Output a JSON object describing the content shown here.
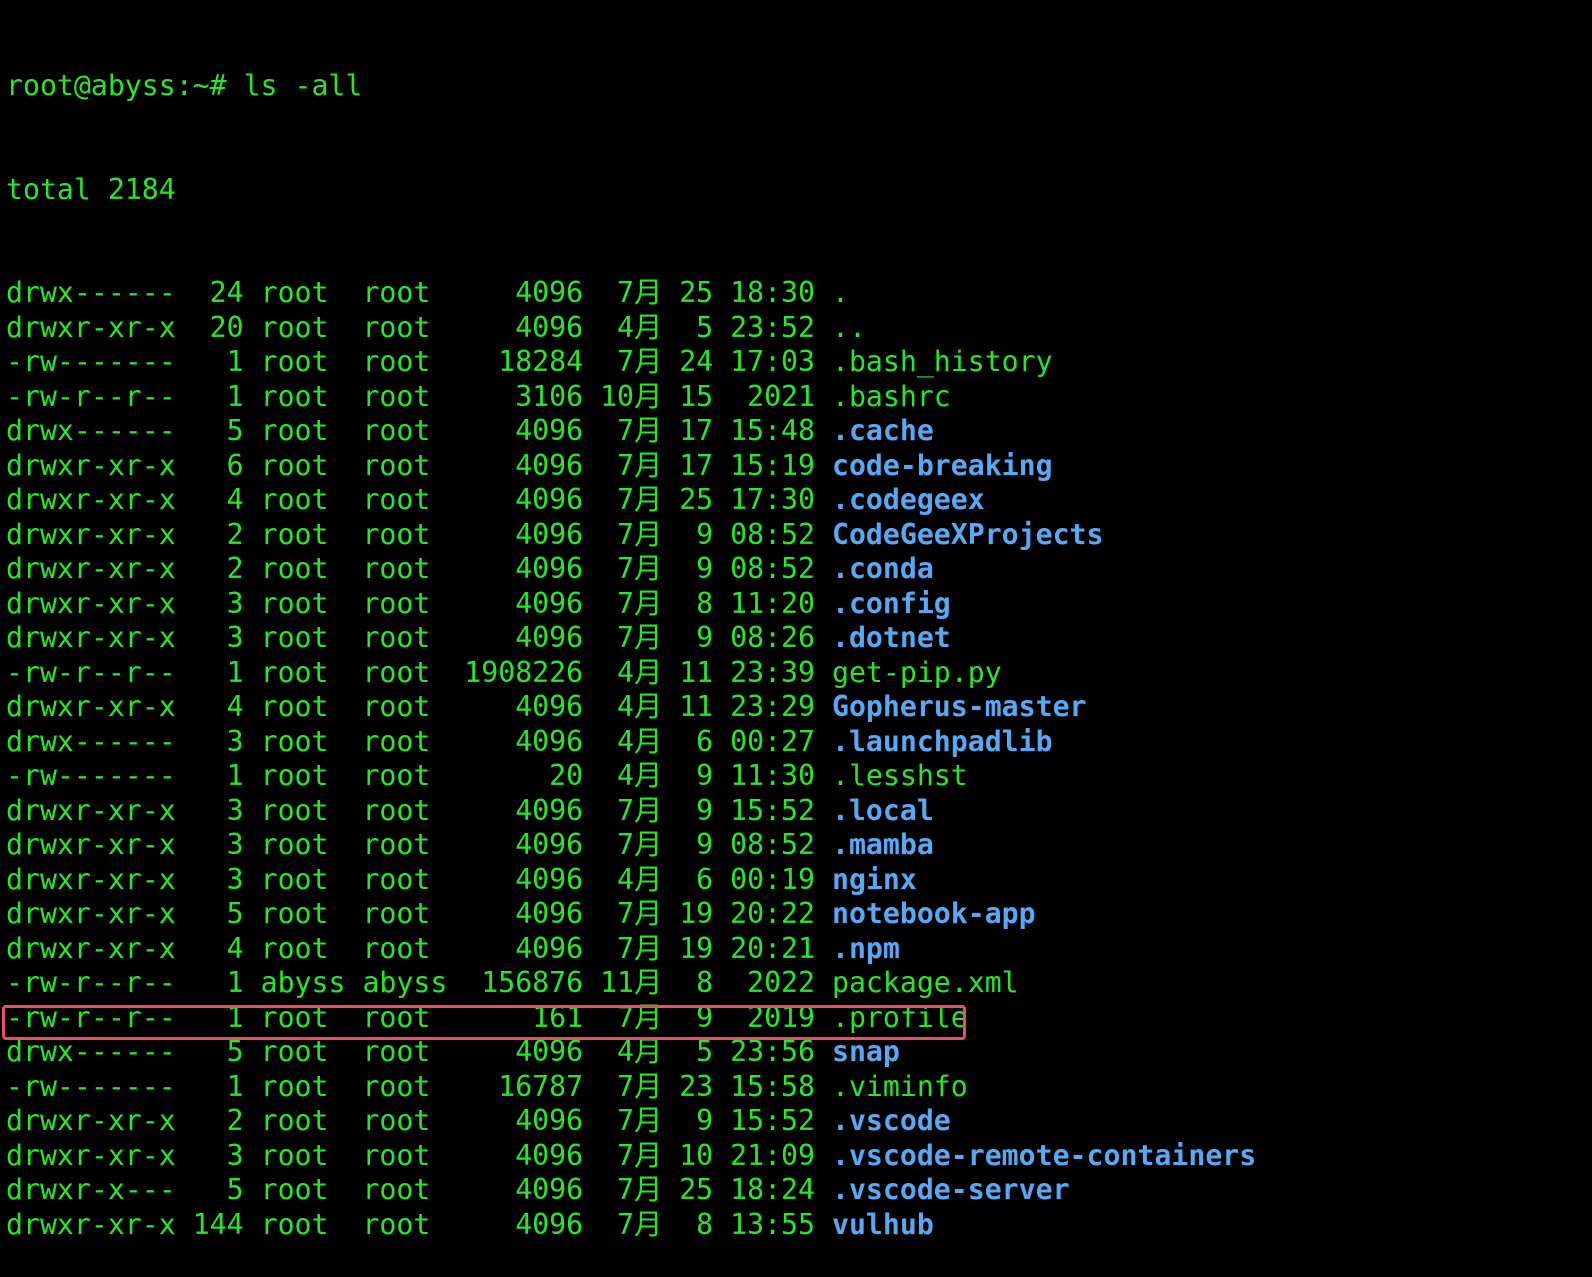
{
  "prompt": "root@abyss:~# ls -all",
  "total": "total 2184",
  "entries": [
    {
      "perm": "drwx------",
      "links": "24",
      "owner": "root",
      "group": "root",
      "size": "4096",
      "month": "7月",
      "day": "25",
      "time": "18:30",
      "name": ".",
      "type": "plain"
    },
    {
      "perm": "drwxr-xr-x",
      "links": "20",
      "owner": "root",
      "group": "root",
      "size": "4096",
      "month": "4月",
      "day": "5",
      "time": "23:52",
      "name": "..",
      "type": "plain"
    },
    {
      "perm": "-rw-------",
      "links": "1",
      "owner": "root",
      "group": "root",
      "size": "18284",
      "month": "7月",
      "day": "24",
      "time": "17:03",
      "name": ".bash_history",
      "type": "plain"
    },
    {
      "perm": "-rw-r--r--",
      "links": "1",
      "owner": "root",
      "group": "root",
      "size": "3106",
      "month": "10月",
      "day": "15",
      "time": "2021",
      "name": ".bashrc",
      "type": "plain"
    },
    {
      "perm": "drwx------",
      "links": "5",
      "owner": "root",
      "group": "root",
      "size": "4096",
      "month": "7月",
      "day": "17",
      "time": "15:48",
      "name": ".cache",
      "type": "dir"
    },
    {
      "perm": "drwxr-xr-x",
      "links": "6",
      "owner": "root",
      "group": "root",
      "size": "4096",
      "month": "7月",
      "day": "17",
      "time": "15:19",
      "name": "code-breaking",
      "type": "dir"
    },
    {
      "perm": "drwxr-xr-x",
      "links": "4",
      "owner": "root",
      "group": "root",
      "size": "4096",
      "month": "7月",
      "day": "25",
      "time": "17:30",
      "name": ".codegeex",
      "type": "dir"
    },
    {
      "perm": "drwxr-xr-x",
      "links": "2",
      "owner": "root",
      "group": "root",
      "size": "4096",
      "month": "7月",
      "day": "9",
      "time": "08:52",
      "name": "CodeGeeXProjects",
      "type": "dir"
    },
    {
      "perm": "drwxr-xr-x",
      "links": "2",
      "owner": "root",
      "group": "root",
      "size": "4096",
      "month": "7月",
      "day": "9",
      "time": "08:52",
      "name": ".conda",
      "type": "dir"
    },
    {
      "perm": "drwxr-xr-x",
      "links": "3",
      "owner": "root",
      "group": "root",
      "size": "4096",
      "month": "7月",
      "day": "8",
      "time": "11:20",
      "name": ".config",
      "type": "dir"
    },
    {
      "perm": "drwxr-xr-x",
      "links": "3",
      "owner": "root",
      "group": "root",
      "size": "4096",
      "month": "7月",
      "day": "9",
      "time": "08:26",
      "name": ".dotnet",
      "type": "dir"
    },
    {
      "perm": "-rw-r--r--",
      "links": "1",
      "owner": "root",
      "group": "root",
      "size": "1908226",
      "month": "4月",
      "day": "11",
      "time": "23:39",
      "name": "get-pip.py",
      "type": "plain"
    },
    {
      "perm": "drwxr-xr-x",
      "links": "4",
      "owner": "root",
      "group": "root",
      "size": "4096",
      "month": "4月",
      "day": "11",
      "time": "23:29",
      "name": "Gopherus-master",
      "type": "dir"
    },
    {
      "perm": "drwx------",
      "links": "3",
      "owner": "root",
      "group": "root",
      "size": "4096",
      "month": "4月",
      "day": "6",
      "time": "00:27",
      "name": ".launchpadlib",
      "type": "dir"
    },
    {
      "perm": "-rw-------",
      "links": "1",
      "owner": "root",
      "group": "root",
      "size": "20",
      "month": "4月",
      "day": "9",
      "time": "11:30",
      "name": ".lesshst",
      "type": "plain"
    },
    {
      "perm": "drwxr-xr-x",
      "links": "3",
      "owner": "root",
      "group": "root",
      "size": "4096",
      "month": "7月",
      "day": "9",
      "time": "15:52",
      "name": ".local",
      "type": "dir"
    },
    {
      "perm": "drwxr-xr-x",
      "links": "3",
      "owner": "root",
      "group": "root",
      "size": "4096",
      "month": "7月",
      "day": "9",
      "time": "08:52",
      "name": ".mamba",
      "type": "dir"
    },
    {
      "perm": "drwxr-xr-x",
      "links": "3",
      "owner": "root",
      "group": "root",
      "size": "4096",
      "month": "4月",
      "day": "6",
      "time": "00:19",
      "name": "nginx",
      "type": "dir"
    },
    {
      "perm": "drwxr-xr-x",
      "links": "5",
      "owner": "root",
      "group": "root",
      "size": "4096",
      "month": "7月",
      "day": "19",
      "time": "20:22",
      "name": "notebook-app",
      "type": "dir"
    },
    {
      "perm": "drwxr-xr-x",
      "links": "4",
      "owner": "root",
      "group": "root",
      "size": "4096",
      "month": "7月",
      "day": "19",
      "time": "20:21",
      "name": ".npm",
      "type": "dir"
    },
    {
      "perm": "-rw-r--r--",
      "links": "1",
      "owner": "abyss",
      "group": "abyss",
      "size": "156876",
      "month": "11月",
      "day": "8",
      "time": "2022",
      "name": "package.xml",
      "type": "plain"
    },
    {
      "perm": "-rw-r--r--",
      "links": "1",
      "owner": "root",
      "group": "root",
      "size": "161",
      "month": "7月",
      "day": "9",
      "time": "2019",
      "name": ".profile",
      "type": "plain"
    },
    {
      "perm": "drwx------",
      "links": "5",
      "owner": "root",
      "group": "root",
      "size": "4096",
      "month": "4月",
      "day": "5",
      "time": "23:56",
      "name": "snap",
      "type": "dir"
    },
    {
      "perm": "-rw-------",
      "links": "1",
      "owner": "root",
      "group": "root",
      "size": "16787",
      "month": "7月",
      "day": "23",
      "time": "15:58",
      "name": ".viminfo",
      "type": "plain"
    },
    {
      "perm": "drwxr-xr-x",
      "links": "2",
      "owner": "root",
      "group": "root",
      "size": "4096",
      "month": "7月",
      "day": "9",
      "time": "15:52",
      "name": ".vscode",
      "type": "dir"
    },
    {
      "perm": "drwxr-xr-x",
      "links": "3",
      "owner": "root",
      "group": "root",
      "size": "4096",
      "month": "7月",
      "day": "10",
      "time": "21:09",
      "name": ".vscode-remote-containers",
      "type": "dir"
    },
    {
      "perm": "drwxr-x---",
      "links": "5",
      "owner": "root",
      "group": "root",
      "size": "4096",
      "month": "7月",
      "day": "25",
      "time": "18:24",
      "name": ".vscode-server",
      "type": "dir"
    },
    {
      "perm": "drwxr-xr-x",
      "links": "144",
      "owner": "root",
      "group": "root",
      "size": "4096",
      "month": "7月",
      "day": "8",
      "time": "13:55",
      "name": "vulhub",
      "type": "dir",
      "highlighted": true
    }
  ],
  "colors": {
    "background": "#000000",
    "text_green": "#27e827",
    "directory_blue": "#57a8f5",
    "highlight_red": "#ea4f5f"
  }
}
